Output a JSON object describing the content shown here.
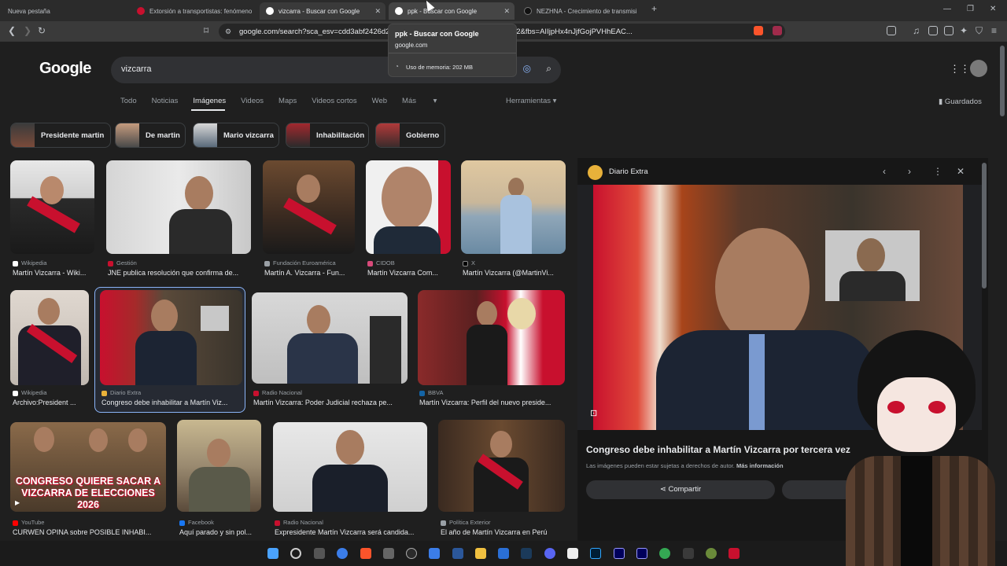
{
  "browser": {
    "tabs": [
      {
        "label": "Nueva pestaña"
      },
      {
        "label": "Extorsión a transportistas: fenómeno"
      },
      {
        "label": "vizcarra - Buscar con Google"
      },
      {
        "label": "ppk - Buscar con Google"
      },
      {
        "label": "NEZHNA - Crecimiento de transmisi"
      }
    ],
    "url": "google.com/search?sca_esv=cdd3abf2426d2...NRCIJPmzw1759991023429&udm=2&fbs=AIIjpHx4nJjfGojPVHhEAC...",
    "new_tab_symbol": "+"
  },
  "tooltip": {
    "title": "ppk - Buscar con Google",
    "domain": "google.com",
    "memory": "Uso de memoria: 202 MB"
  },
  "google": {
    "logo": "Google",
    "query": "vizcarra",
    "filters": [
      "Todo",
      "Noticias",
      "Imágenes",
      "Videos",
      "Maps",
      "Videos cortos",
      "Web",
      "Más"
    ],
    "selected_filter": "Imágenes",
    "tools": "Herramientas",
    "saved": "Guardados",
    "chips": [
      "Presidente martin",
      "De martin",
      "Mario vizcarra",
      "Inhabilitación",
      "Gobierno"
    ]
  },
  "results": [
    {
      "source": "Wikipedia",
      "caption": "Martín Vizcarra - Wiki..."
    },
    {
      "source": "Gestión",
      "caption": "JNE publica resolución que confirma de..."
    },
    {
      "source": "Fundación Euroamérica",
      "caption": "Martín A. Vizcarra - Fun..."
    },
    {
      "source": "CIDOB",
      "caption": "Martín Vizcarra Com..."
    },
    {
      "source": "X",
      "caption": "Martín Vizcarra (@MartinVi..."
    },
    {
      "source": "Wikipedia",
      "caption": "Archivo:President ..."
    },
    {
      "source": "Diario Extra",
      "caption": "Congreso debe inhabilitar a Martín Viz..."
    },
    {
      "source": "Radio Nacional",
      "caption": "Martín Vizcarra: Poder Judicial rechaza pe..."
    },
    {
      "source": "BBVA",
      "caption": "Martín Vizcarra: Perfil del nuevo preside..."
    },
    {
      "source": "YouTube",
      "caption": "CURWEN OPINA sobre POSIBLE INHABI..."
    },
    {
      "source": "Facebook",
      "caption": "Aquí parado y sin pol..."
    },
    {
      "source": "Radio Nacional",
      "caption": "Expresidente Martín Vizcarra será candida..."
    },
    {
      "source": "Política Exterior",
      "caption": "El año de Martín Vizcarra en Perú"
    }
  ],
  "thumb_overlay": {
    "line1": "CONGRESO QUIERE SACAR A",
    "line2": "VIZCARRA DE ELECCIONES 2026"
  },
  "panel": {
    "source": "Diario Extra",
    "title": "Congreso debe inhabilitar a Martín Vizcarra por tercera vez",
    "note": "Las imágenes pueden estar sujetas a derechos de autor.",
    "note_link": "Más información",
    "share": "Compartir"
  },
  "colors": {
    "background": "#1f1f1f",
    "accent": "#8ab4f8",
    "peru_red": "#c8102e"
  }
}
